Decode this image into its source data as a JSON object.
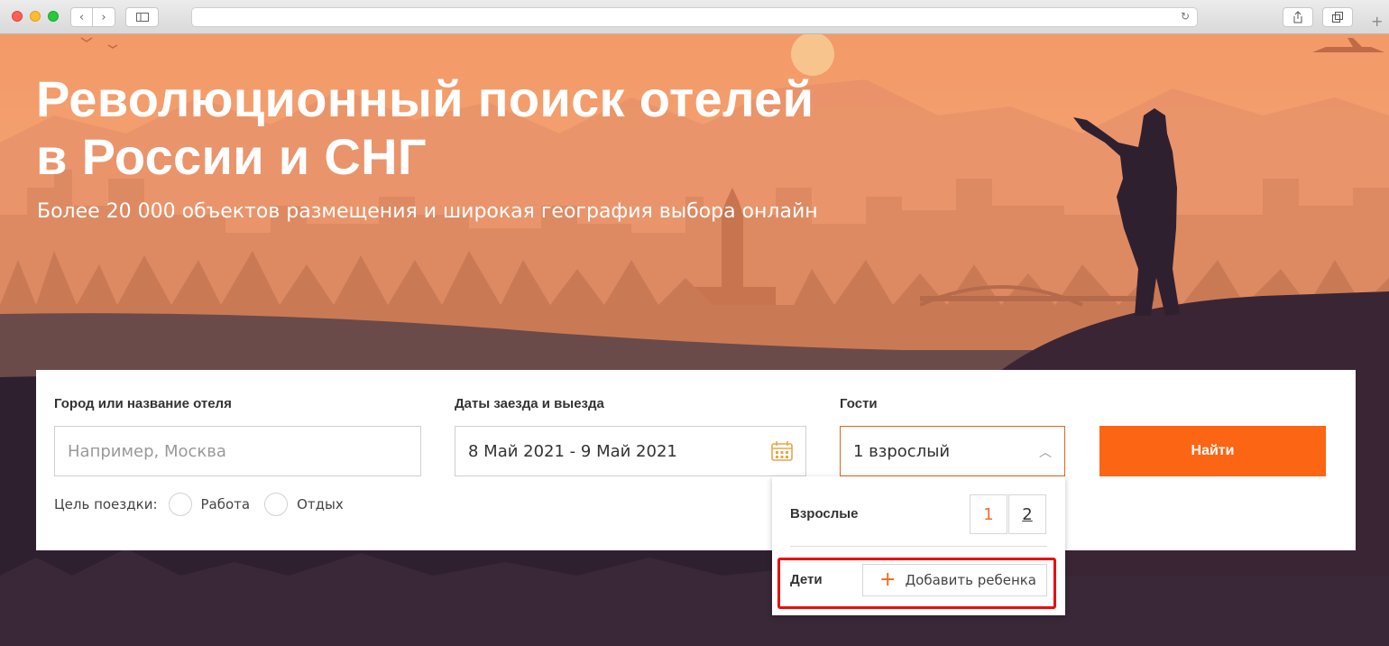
{
  "hero": {
    "title": "Революционный поиск отелей в России и СНГ",
    "subtitle": "Более 20 000 объектов размещения и широкая география выбора онлайн"
  },
  "search": {
    "city_label": "Город или название отеля",
    "city_placeholder": "Например, Москва",
    "dates_label": "Даты заезда и выезда",
    "dates_value": "8 Май 2021 - 9 Май 2021",
    "guests_label": "Гости",
    "guests_value": "1 взрослый",
    "find_button": "Найти",
    "purpose_label": "Цель поездки:",
    "purpose_options": [
      "Работа",
      "Отдых"
    ]
  },
  "guests_dropdown": {
    "adults_label": "Взрослые",
    "adult_options": [
      "1",
      "2"
    ],
    "children_label": "Дети",
    "add_child_label": "Добавить ребенка"
  },
  "colors": {
    "accent": "#fc6514",
    "highlight": "#ee0b0b",
    "sky_top": "#f39a68",
    "silhouette": "#2f2030"
  }
}
